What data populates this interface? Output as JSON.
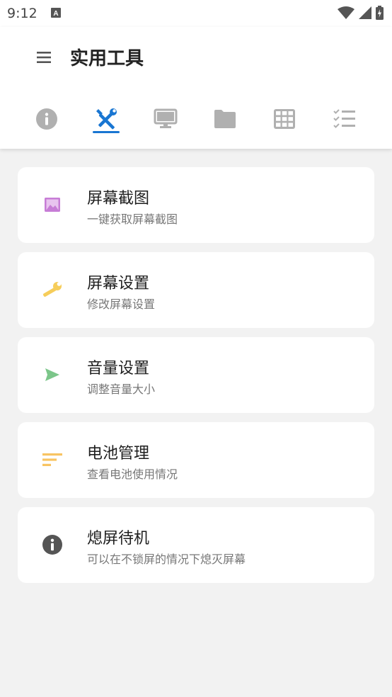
{
  "status": {
    "time": "9:12"
  },
  "header": {
    "title": "实用工具"
  },
  "tabs": [
    {
      "icon": "info-icon",
      "active": false
    },
    {
      "icon": "tools-icon",
      "active": true
    },
    {
      "icon": "monitor-icon",
      "active": false
    },
    {
      "icon": "folder-icon",
      "active": false
    },
    {
      "icon": "grid-icon",
      "active": false
    },
    {
      "icon": "checklist-icon",
      "active": false
    }
  ],
  "colors": {
    "accent": "#1976d2",
    "tabIcon": "#b0b0b0"
  },
  "tools": [
    {
      "title": "屏幕截图",
      "subtitle": "一键获取屏幕截图",
      "icon": "image-icon",
      "color": "#c77dd6"
    },
    {
      "title": "屏幕设置",
      "subtitle": "修改屏幕设置",
      "icon": "wrench-icon",
      "color": "#f6cd5a"
    },
    {
      "title": "音量设置",
      "subtitle": "调整音量大小",
      "icon": "send-icon",
      "color": "#7cc68a"
    },
    {
      "title": "电池管理",
      "subtitle": "查看电池使用情况",
      "icon": "sort-icon",
      "color": "#f8c462"
    },
    {
      "title": "熄屏待机",
      "subtitle": "可以在不锁屏的情况下熄灭屏幕",
      "icon": "info-icon",
      "color": "#555555"
    }
  ]
}
